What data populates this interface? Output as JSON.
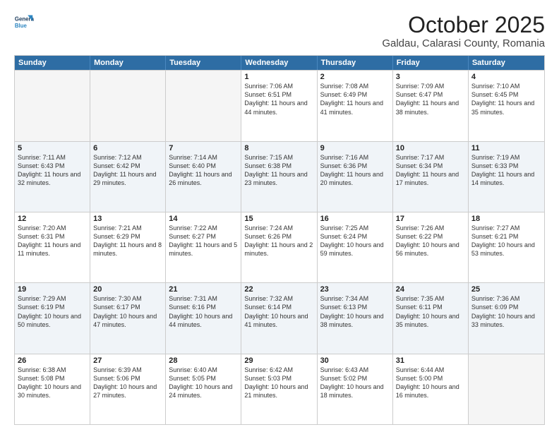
{
  "header": {
    "logo_line1": "General",
    "logo_line2": "Blue",
    "title": "October 2025",
    "subtitle": "Galdau, Calarasi County, Romania"
  },
  "weekdays": [
    "Sunday",
    "Monday",
    "Tuesday",
    "Wednesday",
    "Thursday",
    "Friday",
    "Saturday"
  ],
  "rows": [
    [
      {
        "day": "",
        "text": ""
      },
      {
        "day": "",
        "text": ""
      },
      {
        "day": "",
        "text": ""
      },
      {
        "day": "1",
        "text": "Sunrise: 7:06 AM\nSunset: 6:51 PM\nDaylight: 11 hours\nand 44 minutes."
      },
      {
        "day": "2",
        "text": "Sunrise: 7:08 AM\nSunset: 6:49 PM\nDaylight: 11 hours\nand 41 minutes."
      },
      {
        "day": "3",
        "text": "Sunrise: 7:09 AM\nSunset: 6:47 PM\nDaylight: 11 hours\nand 38 minutes."
      },
      {
        "day": "4",
        "text": "Sunrise: 7:10 AM\nSunset: 6:45 PM\nDaylight: 11 hours\nand 35 minutes."
      }
    ],
    [
      {
        "day": "5",
        "text": "Sunrise: 7:11 AM\nSunset: 6:43 PM\nDaylight: 11 hours\nand 32 minutes."
      },
      {
        "day": "6",
        "text": "Sunrise: 7:12 AM\nSunset: 6:42 PM\nDaylight: 11 hours\nand 29 minutes."
      },
      {
        "day": "7",
        "text": "Sunrise: 7:14 AM\nSunset: 6:40 PM\nDaylight: 11 hours\nand 26 minutes."
      },
      {
        "day": "8",
        "text": "Sunrise: 7:15 AM\nSunset: 6:38 PM\nDaylight: 11 hours\nand 23 minutes."
      },
      {
        "day": "9",
        "text": "Sunrise: 7:16 AM\nSunset: 6:36 PM\nDaylight: 11 hours\nand 20 minutes."
      },
      {
        "day": "10",
        "text": "Sunrise: 7:17 AM\nSunset: 6:34 PM\nDaylight: 11 hours\nand 17 minutes."
      },
      {
        "day": "11",
        "text": "Sunrise: 7:19 AM\nSunset: 6:33 PM\nDaylight: 11 hours\nand 14 minutes."
      }
    ],
    [
      {
        "day": "12",
        "text": "Sunrise: 7:20 AM\nSunset: 6:31 PM\nDaylight: 11 hours\nand 11 minutes."
      },
      {
        "day": "13",
        "text": "Sunrise: 7:21 AM\nSunset: 6:29 PM\nDaylight: 11 hours\nand 8 minutes."
      },
      {
        "day": "14",
        "text": "Sunrise: 7:22 AM\nSunset: 6:27 PM\nDaylight: 11 hours\nand 5 minutes."
      },
      {
        "day": "15",
        "text": "Sunrise: 7:24 AM\nSunset: 6:26 PM\nDaylight: 11 hours\nand 2 minutes."
      },
      {
        "day": "16",
        "text": "Sunrise: 7:25 AM\nSunset: 6:24 PM\nDaylight: 10 hours\nand 59 minutes."
      },
      {
        "day": "17",
        "text": "Sunrise: 7:26 AM\nSunset: 6:22 PM\nDaylight: 10 hours\nand 56 minutes."
      },
      {
        "day": "18",
        "text": "Sunrise: 7:27 AM\nSunset: 6:21 PM\nDaylight: 10 hours\nand 53 minutes."
      }
    ],
    [
      {
        "day": "19",
        "text": "Sunrise: 7:29 AM\nSunset: 6:19 PM\nDaylight: 10 hours\nand 50 minutes."
      },
      {
        "day": "20",
        "text": "Sunrise: 7:30 AM\nSunset: 6:17 PM\nDaylight: 10 hours\nand 47 minutes."
      },
      {
        "day": "21",
        "text": "Sunrise: 7:31 AM\nSunset: 6:16 PM\nDaylight: 10 hours\nand 44 minutes."
      },
      {
        "day": "22",
        "text": "Sunrise: 7:32 AM\nSunset: 6:14 PM\nDaylight: 10 hours\nand 41 minutes."
      },
      {
        "day": "23",
        "text": "Sunrise: 7:34 AM\nSunset: 6:13 PM\nDaylight: 10 hours\nand 38 minutes."
      },
      {
        "day": "24",
        "text": "Sunrise: 7:35 AM\nSunset: 6:11 PM\nDaylight: 10 hours\nand 35 minutes."
      },
      {
        "day": "25",
        "text": "Sunrise: 7:36 AM\nSunset: 6:09 PM\nDaylight: 10 hours\nand 33 minutes."
      }
    ],
    [
      {
        "day": "26",
        "text": "Sunrise: 6:38 AM\nSunset: 5:08 PM\nDaylight: 10 hours\nand 30 minutes."
      },
      {
        "day": "27",
        "text": "Sunrise: 6:39 AM\nSunset: 5:06 PM\nDaylight: 10 hours\nand 27 minutes."
      },
      {
        "day": "28",
        "text": "Sunrise: 6:40 AM\nSunset: 5:05 PM\nDaylight: 10 hours\nand 24 minutes."
      },
      {
        "day": "29",
        "text": "Sunrise: 6:42 AM\nSunset: 5:03 PM\nDaylight: 10 hours\nand 21 minutes."
      },
      {
        "day": "30",
        "text": "Sunrise: 6:43 AM\nSunset: 5:02 PM\nDaylight: 10 hours\nand 18 minutes."
      },
      {
        "day": "31",
        "text": "Sunrise: 6:44 AM\nSunset: 5:00 PM\nDaylight: 10 hours\nand 16 minutes."
      },
      {
        "day": "",
        "text": ""
      }
    ]
  ]
}
